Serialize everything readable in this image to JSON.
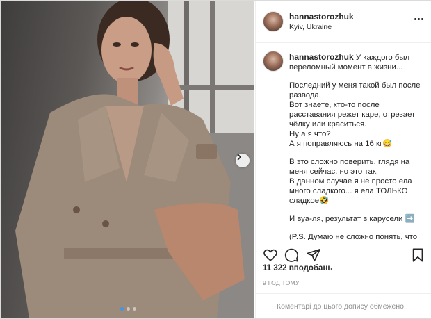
{
  "post": {
    "username": "hannastorozhuk",
    "location": "Kyiv, Ukraine",
    "caption": {
      "first_line": "У каждого был переломный момент в жизни...",
      "p2": [
        "Последний у меня такой был после развода.",
        "Вот знаете, кто-то после расставания режет каре, отрезает чёлку или краситься.",
        "Ну а я что?",
        "А я поправляюсь на 16 кг😅"
      ],
      "p3": [
        "В это сложно поверить, глядя на меня сейчас, но это так.",
        "В данном случае я не просто ела много сладкого... я ела ТОЛЬКО сладкое🤣"
      ],
      "p4": "И вуа-ля, результат в карусели ➡️",
      "p5": "(P.S. Думаю не сложно понять, что"
    },
    "likes": "11 322 вподобань",
    "time_ago": "9 ГОД ТОМУ",
    "comments_disabled": "Коментарі до цього допису обмежено."
  },
  "carousel": {
    "total": 3,
    "active_index": 0
  },
  "icons": {
    "more": "more-options-icon",
    "like": "heart-icon",
    "comment": "comment-icon",
    "share": "share-icon",
    "save": "bookmark-icon",
    "next": "chevron-right-icon"
  },
  "colors": {
    "accent": "#3897f0",
    "text": "#262626",
    "muted": "#8e8e8e",
    "border": "#efefef"
  }
}
